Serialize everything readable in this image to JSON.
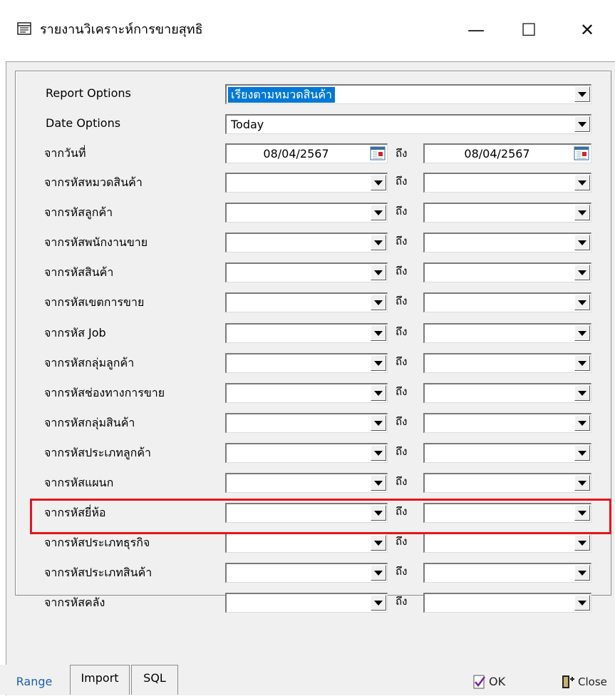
{
  "window": {
    "title": "รายงานวิเคราะห์การขายสุทธิ",
    "minimize_glyph": "—",
    "maximize_glyph": "☐",
    "close_glyph": "✕"
  },
  "report_options": {
    "label": "Report Options",
    "value": "เรียงตามหมวดสินค้า"
  },
  "date_options": {
    "label": "Date Options",
    "value": "Today"
  },
  "date_range": {
    "label": "จากวันที่",
    "from": "08/04/2567",
    "to_label": "ถึง",
    "to": "08/04/2567"
  },
  "range_rows": [
    {
      "label": "จากรหัสหมวดสินค้า",
      "to_label": "ถึง"
    },
    {
      "label": "จากรหัสลูกค้า",
      "to_label": "ถึง"
    },
    {
      "label": "จากรหัสพนักงานขาย",
      "to_label": "ถึง"
    },
    {
      "label": "จากรหัสสินค้า",
      "to_label": "ถึง"
    },
    {
      "label": "จากรหัสเขตการขาย",
      "to_label": "ถึง"
    },
    {
      "label": "จากรหัส Job",
      "to_label": "ถึง"
    },
    {
      "label": "จากรหัสกลุ่มลูกค้า",
      "to_label": "ถึง"
    },
    {
      "label": "จากรหัสช่องทางการขาย",
      "to_label": "ถึง"
    },
    {
      "label": "จากรหัสกลุ่มสินค้า",
      "to_label": "ถึง"
    },
    {
      "label": "จากรหัสประเภทลูกค้า",
      "to_label": "ถึง"
    },
    {
      "label": "จากรหัสแผนก",
      "to_label": "ถึง"
    },
    {
      "label": "จากรหัสยี่ห้อ",
      "to_label": "ถึง"
    },
    {
      "label": "จากรหัสประเภทธุรกิจ",
      "to_label": "ถึง"
    },
    {
      "label": "จากรหัสประเภทสินค้า",
      "to_label": "ถึง"
    },
    {
      "label": "จากรหัสคลัง",
      "to_label": "ถึง"
    }
  ],
  "tabs": [
    {
      "label": "Range",
      "active": true
    },
    {
      "label": "Import",
      "active": false
    },
    {
      "label": "SQL",
      "active": false
    }
  ],
  "buttons": {
    "ok": "OK",
    "close": "Close"
  },
  "colors": {
    "highlight": "#e8141b",
    "selection": "#0078d7",
    "active_tab_text": "#1a5fb4"
  }
}
